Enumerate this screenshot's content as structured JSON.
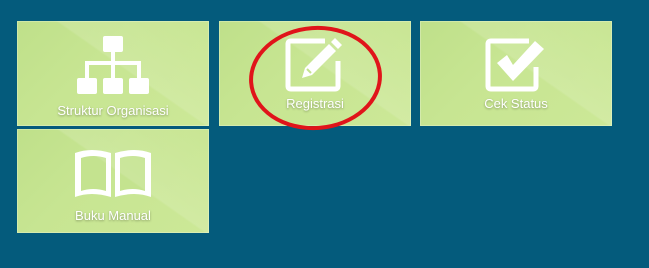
{
  "tiles": [
    {
      "label": "Struktur Organisasi",
      "icon": "org-chart-icon"
    },
    {
      "label": "Registrasi",
      "icon": "edit-pencil-icon"
    },
    {
      "label": "Cek Status",
      "icon": "checkbox-check-icon"
    },
    {
      "label": "Buku Manual",
      "icon": "open-book-icon"
    }
  ],
  "colors": {
    "background": "#045b7c",
    "tile": "#c4e38f",
    "tile_text": "#ffffff",
    "highlight": "#e0141a"
  }
}
